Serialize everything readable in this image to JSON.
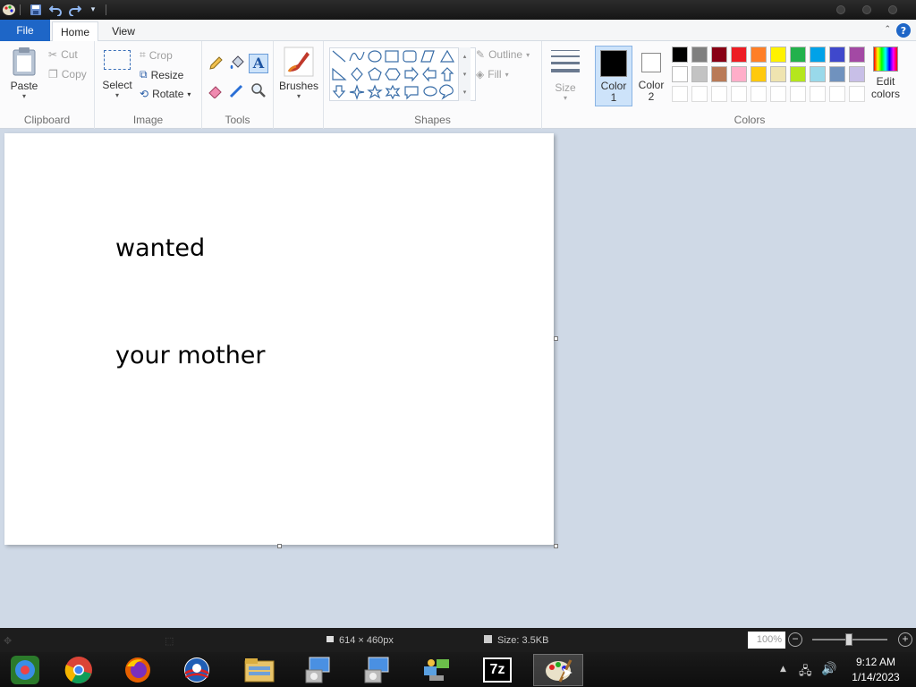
{
  "quick_access": {
    "icons": [
      "paint-app-icon",
      "save-icon",
      "undo-icon",
      "redo-icon",
      "customize-qat-icon"
    ]
  },
  "tabs": {
    "file": "File",
    "home": "Home",
    "view": "View",
    "help": "?"
  },
  "ribbon": {
    "clipboard": {
      "paste": "Paste",
      "cut": "Cut",
      "copy": "Copy",
      "label": "Clipboard"
    },
    "image": {
      "select": "Select",
      "crop": "Crop",
      "resize": "Resize",
      "rotate": "Rotate",
      "label": "Image"
    },
    "tools": {
      "label": "Tools"
    },
    "brushes": {
      "label": "Brushes"
    },
    "shapes": {
      "outline": "Outline",
      "fill": "Fill",
      "label": "Shapes"
    },
    "size": {
      "label": "Size"
    },
    "color1": {
      "label_line1": "Color",
      "label_line2": "1",
      "value": "#000000"
    },
    "color2": {
      "label_line1": "Color",
      "label_line2": "2",
      "value": "#ffffff"
    },
    "colors": {
      "label": "Colors",
      "edit_line1": "Edit",
      "edit_line2": "colors",
      "row1": [
        "#000000",
        "#7f7f7f",
        "#880015",
        "#ed1c24",
        "#ff7f27",
        "#fff200",
        "#22b14c",
        "#00a2e8",
        "#3f48cc",
        "#a349a4"
      ],
      "row2": [
        "#ffffff",
        "#c3c3c3",
        "#b97a57",
        "#ffaec9",
        "#ffc90e",
        "#efe4b0",
        "#b5e61d",
        "#99d9ea",
        "#7092be",
        "#c8bfe7"
      ]
    }
  },
  "canvas": {
    "text1": "wanted",
    "text2": "your mother"
  },
  "status": {
    "dimensions": "614 × 460px",
    "size": "Size: 3.5KB",
    "zoom": "100%",
    "zoom_minus": "−",
    "zoom_plus": "+"
  },
  "taskbar": {
    "apps": [
      "start-orb-icon",
      "chrome-icon",
      "firefox-icon",
      "obama-logo-icon",
      "file-explorer-icon",
      "installer-icon",
      "installer-icon-2",
      "network-app-icon",
      "7zip-icon",
      "paint-taskbar-icon"
    ],
    "sevenzip_label": "7z",
    "time": "9:12 AM",
    "date": "1/14/2023"
  }
}
